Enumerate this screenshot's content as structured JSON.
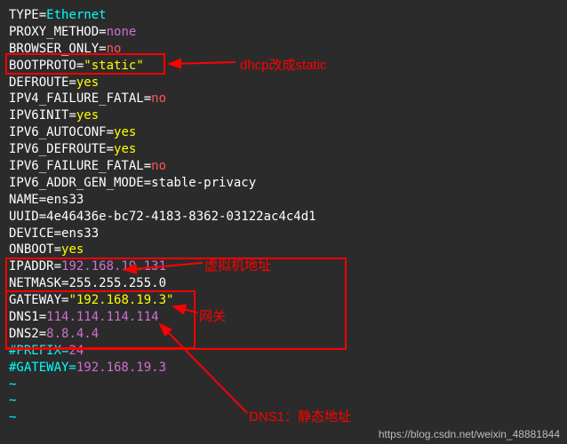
{
  "lines": [
    {
      "key": "TYPE",
      "val": "Ethernet",
      "valClass": "val-cyan"
    },
    {
      "key": "PROXY_METHOD",
      "val": "none",
      "valClass": "val-purple"
    },
    {
      "key": "BROWSER_ONLY",
      "val": "no",
      "valClass": "val-red"
    },
    {
      "key": "BOOTPROTO",
      "val": "\"static\"",
      "valClass": "val-yellow"
    },
    {
      "key": "DEFROUTE",
      "val": "yes",
      "valClass": "val-yellow"
    },
    {
      "key": "IPV4_FAILURE_FATAL",
      "val": "no",
      "valClass": "val-red"
    },
    {
      "key": "IPV6INIT",
      "val": "yes",
      "valClass": "val-yellow"
    },
    {
      "key": "IPV6_AUTOCONF",
      "val": "yes",
      "valClass": "val-yellow"
    },
    {
      "key": "IPV6_DEFROUTE",
      "val": "yes",
      "valClass": "val-yellow"
    },
    {
      "key": "IPV6_FAILURE_FATAL",
      "val": "no",
      "valClass": "val-red"
    },
    {
      "key": "IPV6_ADDR_GEN_MODE",
      "val": "stable-privacy",
      "valClass": "val-white"
    },
    {
      "key": "NAME",
      "val": "ens33",
      "valClass": "val-white"
    },
    {
      "key": "UUID",
      "val": "4e46436e-bc72-4183-8362-03122ac4c4d1",
      "valClass": "val-white"
    },
    {
      "key": "DEVICE",
      "val": "ens33",
      "valClass": "val-white"
    },
    {
      "key": "ONBOOT",
      "val": "yes",
      "valClass": "val-yellow"
    },
    {
      "key": "IPADDR",
      "val": "192.168.19.131",
      "valClass": "val-purple"
    },
    {
      "key": "NETMASK",
      "val": "255.255.255.0",
      "valClass": "val-white"
    },
    {
      "key": "GATEWAY",
      "val": "\"192.168.19.3\"",
      "valClass": "val-yellow"
    },
    {
      "key": "DNS1",
      "val": "114.114.114.114",
      "valClass": "val-purple"
    },
    {
      "key": "DNS2",
      "val": "8.8.4.4",
      "valClass": "val-purple"
    }
  ],
  "comments": [
    "#PREFIX=24",
    "#GATEWAY=192.168.19.3"
  ],
  "tildes": [
    "~",
    "~",
    "~"
  ],
  "annotations": {
    "ann1": "dhcp改成static",
    "ann2": "虚拟机地址",
    "ann3": "网关",
    "ann4": "DNS1：静态地址"
  },
  "watermark": "https://blog.csdn.net/weixin_48881844"
}
